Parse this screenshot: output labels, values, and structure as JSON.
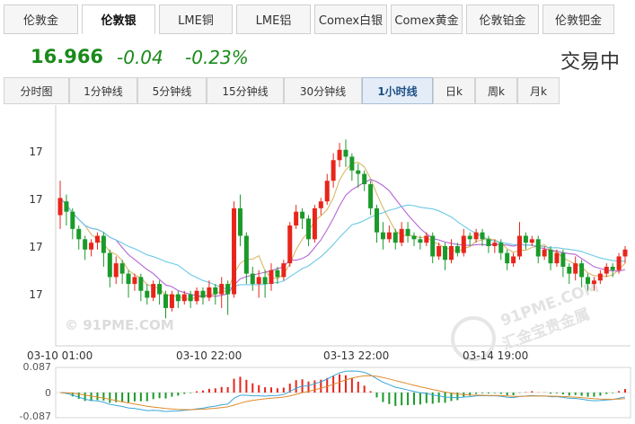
{
  "market_tabs": [
    {
      "label": "伦敦金",
      "active": false
    },
    {
      "label": "伦敦银",
      "active": true
    },
    {
      "label": "LME铜",
      "active": false
    },
    {
      "label": "LME铝",
      "active": false
    },
    {
      "label": "Comex白银",
      "active": false
    },
    {
      "label": "Comex黄金",
      "active": false
    },
    {
      "label": "伦敦铂金",
      "active": false
    },
    {
      "label": "伦敦钯金",
      "active": false
    }
  ],
  "quote": {
    "price": "16.966",
    "change": "-0.04",
    "change_percent": "-0.23%",
    "status": "交易中",
    "color": "#1a8a1a"
  },
  "period_tabs": [
    {
      "label": "分时图",
      "active": false
    },
    {
      "label": "1分钟线",
      "active": false
    },
    {
      "label": "5分钟线",
      "active": false
    },
    {
      "label": "15分钟线",
      "active": false
    },
    {
      "label": "30分钟线",
      "active": false
    },
    {
      "label": "1小时线",
      "active": true
    },
    {
      "label": "日k",
      "active": false
    },
    {
      "label": "周k",
      "active": false
    },
    {
      "label": "月k",
      "active": false
    }
  ],
  "watermarks": {
    "left": "© 91PME.COM",
    "right_line1": "91PME.COM",
    "right_line2": "汇金宝贵金属"
  },
  "chart_data": {
    "type": "candlestick",
    "y_tick_labels": [
      "17",
      "17",
      "17",
      "17"
    ],
    "x_tick_labels": [
      "03-10 01:00",
      "03-10 22:00",
      "03-13 22:00",
      "03-14 19:00"
    ],
    "ylim": [
      16.64,
      17.34
    ],
    "up_color": "#e8251b",
    "down_color": "#1a9a2a",
    "ma_colors": [
      "#d9b86a",
      "#b566d4",
      "#6cc9e6"
    ],
    "ohlc": [
      [
        17.02,
        17.07,
        17.12,
        16.98
      ],
      [
        17.06,
        17.03,
        17.08,
        16.99
      ],
      [
        17.03,
        16.98,
        17.04,
        16.95
      ],
      [
        16.98,
        16.95,
        16.99,
        16.92
      ],
      [
        16.95,
        16.92,
        16.96,
        16.89
      ],
      [
        16.92,
        16.94,
        16.95,
        16.9
      ],
      [
        16.94,
        16.96,
        16.97,
        16.92
      ],
      [
        16.96,
        16.91,
        16.97,
        16.87
      ],
      [
        16.91,
        16.84,
        16.92,
        16.81
      ],
      [
        16.84,
        16.88,
        16.9,
        16.82
      ],
      [
        16.88,
        16.85,
        16.89,
        16.82
      ],
      [
        16.85,
        16.82,
        16.86,
        16.78
      ],
      [
        16.82,
        16.84,
        16.85,
        16.8
      ],
      [
        16.84,
        16.8,
        16.85,
        16.77
      ],
      [
        16.8,
        16.78,
        16.82,
        16.76
      ],
      [
        16.78,
        16.82,
        16.83,
        16.77
      ],
      [
        16.82,
        16.79,
        16.83,
        16.76
      ],
      [
        16.79,
        16.75,
        16.8,
        16.72
      ],
      [
        16.75,
        16.79,
        16.8,
        16.74
      ],
      [
        16.79,
        16.77,
        16.8,
        16.75
      ],
      [
        16.77,
        16.79,
        16.8,
        16.76
      ],
      [
        16.79,
        16.77,
        16.8,
        16.75
      ],
      [
        16.77,
        16.8,
        16.81,
        16.76
      ],
      [
        16.8,
        16.78,
        16.81,
        16.76
      ],
      [
        16.78,
        16.81,
        16.83,
        16.77
      ],
      [
        16.81,
        16.79,
        16.82,
        16.76
      ],
      [
        16.79,
        16.82,
        16.84,
        16.75
      ],
      [
        16.82,
        16.79,
        16.83,
        16.73
      ],
      [
        16.79,
        17.04,
        17.06,
        16.78
      ],
      [
        17.04,
        16.96,
        17.08,
        16.93
      ],
      [
        16.96,
        16.85,
        16.97,
        16.82
      ],
      [
        16.85,
        16.82,
        16.87,
        16.8
      ],
      [
        16.82,
        16.84,
        16.86,
        16.78
      ],
      [
        16.84,
        16.82,
        16.86,
        16.78
      ],
      [
        16.82,
        16.86,
        16.88,
        16.8
      ],
      [
        16.86,
        16.84,
        16.87,
        16.82
      ],
      [
        16.84,
        16.88,
        16.89,
        16.83
      ],
      [
        16.88,
        16.99,
        17.0,
        16.87
      ],
      [
        16.99,
        17.03,
        17.05,
        16.98
      ],
      [
        17.03,
        17.01,
        17.04,
        16.98
      ],
      [
        17.01,
        16.95,
        17.02,
        16.93
      ],
      [
        16.95,
        17.04,
        17.05,
        16.94
      ],
      [
        17.04,
        17.06,
        17.07,
        17.02
      ],
      [
        17.06,
        17.12,
        17.14,
        17.05
      ],
      [
        17.12,
        17.18,
        17.2,
        17.1
      ],
      [
        17.18,
        17.21,
        17.23,
        17.16
      ],
      [
        17.21,
        17.19,
        17.24,
        17.16
      ],
      [
        17.19,
        17.15,
        17.2,
        17.12
      ],
      [
        17.15,
        17.14,
        17.17,
        17.1
      ],
      [
        17.14,
        17.11,
        17.15,
        17.09
      ],
      [
        17.11,
        17.04,
        17.12,
        17.02
      ],
      [
        17.04,
        16.97,
        17.05,
        16.94
      ],
      [
        16.97,
        16.95,
        17.0,
        16.92
      ],
      [
        16.95,
        16.97,
        16.99,
        16.94
      ],
      [
        16.97,
        16.94,
        16.98,
        16.92
      ],
      [
        16.94,
        16.98,
        17.0,
        16.93
      ],
      [
        16.98,
        16.96,
        17.0,
        16.94
      ],
      [
        16.96,
        16.95,
        16.97,
        16.93
      ],
      [
        16.95,
        16.94,
        16.96,
        16.92
      ],
      [
        16.94,
        16.96,
        16.97,
        16.93
      ],
      [
        16.96,
        16.9,
        16.97,
        16.88
      ],
      [
        16.9,
        16.93,
        16.94,
        16.89
      ],
      [
        16.93,
        16.89,
        16.94,
        16.86
      ],
      [
        16.89,
        16.93,
        16.95,
        16.88
      ],
      [
        16.93,
        16.91,
        16.94,
        16.9
      ],
      [
        16.91,
        16.96,
        16.98,
        16.9
      ],
      [
        16.96,
        16.95,
        16.97,
        16.93
      ],
      [
        16.95,
        16.97,
        16.98,
        16.94
      ],
      [
        16.97,
        16.95,
        16.98,
        16.93
      ],
      [
        16.95,
        16.93,
        16.96,
        16.91
      ],
      [
        16.93,
        16.94,
        16.95,
        16.91
      ],
      [
        16.94,
        16.91,
        16.95,
        16.89
      ],
      [
        16.91,
        16.88,
        16.92,
        16.86
      ],
      [
        16.88,
        16.9,
        16.91,
        16.87
      ],
      [
        16.9,
        16.96,
        17.0,
        16.89
      ],
      [
        16.96,
        16.94,
        16.97,
        16.92
      ],
      [
        16.94,
        16.95,
        16.96,
        16.93
      ],
      [
        16.95,
        16.9,
        16.96,
        16.88
      ],
      [
        16.9,
        16.92,
        16.93,
        16.89
      ],
      [
        16.92,
        16.88,
        16.93,
        16.86
      ],
      [
        16.88,
        16.91,
        16.92,
        16.87
      ],
      [
        16.91,
        16.87,
        16.92,
        16.84
      ],
      [
        16.87,
        16.85,
        16.88,
        16.82
      ],
      [
        16.85,
        16.88,
        16.9,
        16.83
      ],
      [
        16.88,
        16.84,
        16.89,
        16.81
      ],
      [
        16.84,
        16.82,
        16.85,
        16.8
      ],
      [
        16.82,
        16.83,
        16.84,
        16.8
      ],
      [
        16.83,
        16.85,
        16.86,
        16.82
      ],
      [
        16.85,
        16.87,
        16.88,
        16.84
      ],
      [
        16.87,
        16.86,
        16.88,
        16.84
      ],
      [
        16.86,
        16.9,
        16.91,
        16.85
      ],
      [
        16.9,
        16.92,
        16.93,
        16.88
      ]
    ],
    "macd_ticks": [
      "0.087",
      "0",
      "-0.087"
    ]
  }
}
